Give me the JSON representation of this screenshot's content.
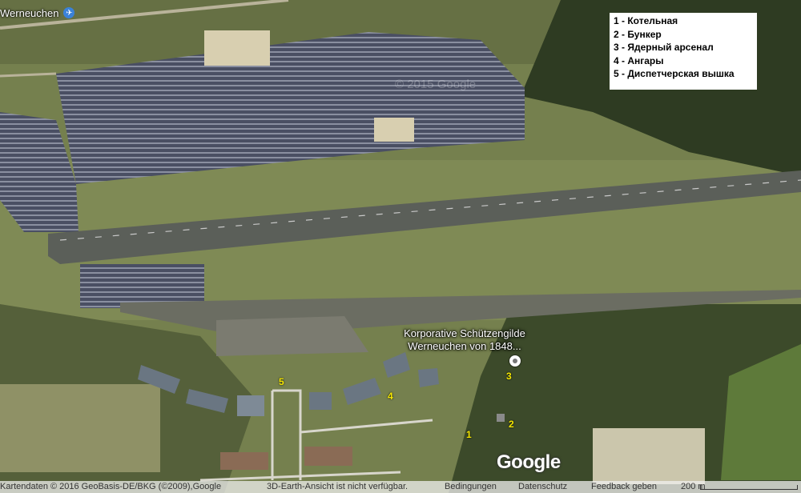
{
  "place_label": "Werneuchen",
  "place_icon": "airport-icon",
  "legend": {
    "items": [
      "1 - Котельная",
      "2 - Бункер",
      "3 - Ядерный арсенал",
      "4 - Ангары",
      "5 - Диспетчерская вышка"
    ]
  },
  "poi": {
    "line1": "Korporative Schützengilde",
    "line2": "Werneuchen von 1848..."
  },
  "markers": {
    "m1": "1",
    "m2": "2",
    "m3": "3",
    "m4": "4",
    "m5": "5"
  },
  "brand": "Google",
  "watermark": "© 2015 Google",
  "footer": {
    "copyright": "Kartendaten © 2016 GeoBasis-DE/BKG (©2009),Google",
    "earth_notice": "3D-Earth-Ansicht ist nicht verfügbar.",
    "terms": "Bedingungen",
    "privacy": "Datenschutz",
    "feedback": "Feedback geben",
    "scale": "200 m"
  },
  "colors": {
    "marker_numbers": "#f5e600",
    "legend_bg": "#ffffff"
  }
}
